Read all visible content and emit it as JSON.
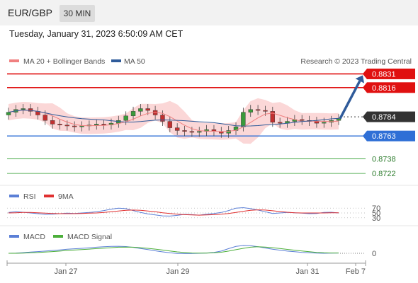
{
  "header": {
    "symbol": "EUR/GBP",
    "timeframe": "30 MIN",
    "datetime": "Tuesday, January 31, 2023 6:50:09 AM CET"
  },
  "price_panel": {
    "legend": [
      {
        "label": "MA 20 + Bollinger Bands",
        "color": "#f08080"
      },
      {
        "label": "MA 50",
        "color": "#2f5b9a"
      }
    ],
    "credit": "Research © 2023 Trading Central"
  },
  "rsi_panel": {
    "legend": [
      {
        "label": "RSI",
        "color": "#5b7fd6"
      },
      {
        "label": "9MA",
        "color": "#e03030"
      }
    ],
    "levels": [
      "70",
      "50",
      "30"
    ]
  },
  "macd_panel": {
    "legend": [
      {
        "label": "MACD",
        "color": "#5b7fd6"
      },
      {
        "label": "MACD Signal",
        "color": "#4caf3a"
      }
    ],
    "zero_label": "0"
  },
  "x_axis": [
    "Jan 27",
    "Jan 29",
    "Jan 31",
    "Feb 7"
  ],
  "colors": {
    "resistance": "#e01010",
    "support": "#2f6fd6",
    "target": "#2e9e2e",
    "current": "#333333",
    "arrow": "#2f5b9a",
    "bullish": "#3a9a3a",
    "bearish": "#c03030"
  },
  "chart_data": [
    {
      "type": "candlestick",
      "title": "EUR/GBP",
      "ylim": [
        0.8712,
        0.8836
      ],
      "levels": [
        {
          "value": "0.8831",
          "kind": "resistance"
        },
        {
          "value": "0.8816",
          "kind": "resistance"
        },
        {
          "value": "0.8784",
          "kind": "current"
        },
        {
          "value": "0.8763",
          "kind": "support"
        },
        {
          "value": "0.8738",
          "kind": "target"
        },
        {
          "value": "0.8722",
          "kind": "target"
        }
      ],
      "close_series": [
        0.8789,
        0.8792,
        0.8793,
        0.879,
        0.8786,
        0.878,
        0.8776,
        0.8775,
        0.8774,
        0.8773,
        0.8774,
        0.8775,
        0.8776,
        0.8775,
        0.8777,
        0.878,
        0.8785,
        0.879,
        0.8793,
        0.8791,
        0.8786,
        0.8779,
        0.8772,
        0.8769,
        0.8768,
        0.8767,
        0.8768,
        0.877,
        0.8768,
        0.8766,
        0.8769,
        0.8773,
        0.8789,
        0.8792,
        0.8791,
        0.879,
        0.8778,
        0.8777,
        0.8779,
        0.8781,
        0.878,
        0.8779,
        0.8777,
        0.8778,
        0.878,
        0.8782
      ],
      "forecast": [
        0.8782,
        0.8831
      ]
    },
    {
      "type": "line",
      "title": "RSI",
      "series": [
        {
          "name": "RSI",
          "values": [
            52,
            55,
            53,
            50,
            47,
            44,
            45,
            47,
            49,
            48,
            50,
            52,
            55,
            60,
            66,
            70,
            68,
            60,
            52,
            46,
            42,
            38,
            37,
            40,
            44,
            43,
            41,
            45,
            48,
            52,
            60,
            70,
            72,
            68,
            62,
            55,
            48,
            50,
            52,
            51,
            49,
            47,
            48,
            52,
            53,
            50
          ]
        },
        {
          "name": "9MA",
          "values": [
            50,
            51,
            52,
            52,
            51,
            49,
            48,
            47,
            47,
            47,
            48,
            49,
            50,
            52,
            55,
            58,
            61,
            62,
            61,
            58,
            55,
            51,
            48,
            45,
            43,
            42,
            41,
            42,
            43,
            45,
            48,
            52,
            57,
            61,
            63,
            62,
            59,
            56,
            53,
            51,
            50,
            50,
            50,
            50,
            51,
            51
          ]
        }
      ],
      "ylim": [
        0,
        100
      ]
    },
    {
      "type": "line",
      "title": "MACD",
      "series": [
        {
          "name": "MACD",
          "values": [
            0.0,
            0.1,
            0.4,
            0.8,
            1.1,
            1.4,
            1.8,
            2.2,
            2.6,
            2.9,
            3.2,
            3.5,
            3.9,
            4.2,
            4.4,
            4.5,
            4.3,
            3.8,
            3.1,
            2.4,
            1.6,
            0.9,
            0.3,
            -0.1,
            -0.2,
            -0.1,
            0.0,
            0.2,
            0.6,
            1.4,
            3.0,
            4.4,
            5.0,
            4.9,
            4.2,
            3.4,
            2.6,
            2.0,
            1.4,
            1.0,
            0.6,
            0.3,
            0.1,
            0.0,
            0.1,
            0.2
          ]
        },
        {
          "name": "MACD Signal",
          "values": [
            0.0,
            0.0,
            0.1,
            0.3,
            0.5,
            0.8,
            1.1,
            1.4,
            1.8,
            2.1,
            2.4,
            2.7,
            3.0,
            3.3,
            3.6,
            3.9,
            4.0,
            3.9,
            3.6,
            3.2,
            2.7,
            2.1,
            1.5,
            0.9,
            0.5,
            0.2,
            0.1,
            0.1,
            0.3,
            0.7,
            1.4,
            2.3,
            3.2,
            3.9,
            4.2,
            4.0,
            3.6,
            3.1,
            2.5,
            2.0,
            1.5,
            1.0,
            0.6,
            0.3,
            0.2,
            0.2
          ]
        }
      ],
      "ylim": [
        -2,
        6
      ]
    }
  ]
}
